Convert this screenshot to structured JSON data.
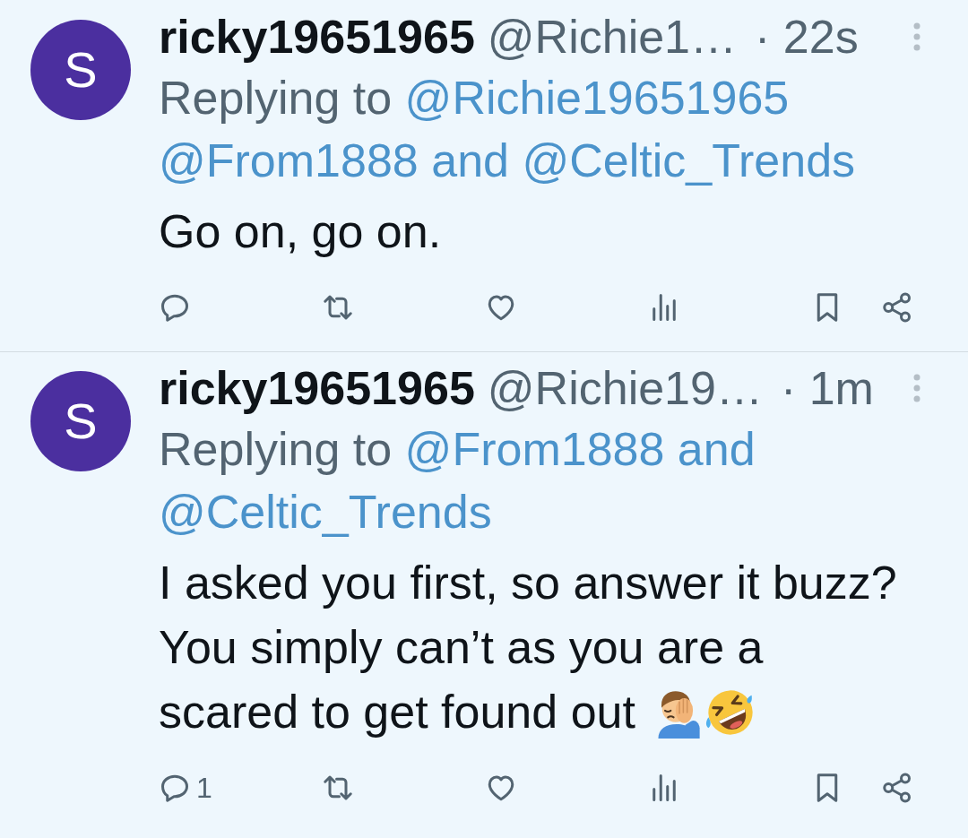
{
  "tweets": [
    {
      "avatar": {
        "letter": "S"
      },
      "display_name": "ricky19651965",
      "handle": "@Richie1…",
      "time": "· 22s",
      "replying_to": {
        "label": "Replying to",
        "mentions": [
          "@Richie19651965",
          "@From1888",
          "@Celtic_Trends"
        ],
        "joiner": "and"
      },
      "text": "Go on, go on.",
      "actions": [
        {
          "kind": "reply"
        },
        {
          "kind": "repost"
        },
        {
          "kind": "like"
        },
        {
          "kind": "views"
        },
        {
          "kind": "bookmark"
        },
        {
          "kind": "share"
        }
      ]
    },
    {
      "avatar": {
        "letter": "S"
      },
      "display_name": "ricky19651965",
      "handle": "@Richie19…",
      "time": "· 1m",
      "replying_to": {
        "label": "Replying to",
        "mentions": [
          "@From1888",
          "@Celtic_Trends"
        ],
        "joiner": "and"
      },
      "text": "I asked you first, so answer it buzz? You simply can’t as you are a scared to get found out",
      "emojis": [
        {
          "kind": "facepalm"
        },
        {
          "kind": "rolling_laughing"
        }
      ],
      "actions": [
        {
          "kind": "reply",
          "count": "1"
        },
        {
          "kind": "repost"
        },
        {
          "kind": "like"
        },
        {
          "kind": "views"
        },
        {
          "kind": "bookmark"
        },
        {
          "kind": "share"
        }
      ]
    }
  ]
}
